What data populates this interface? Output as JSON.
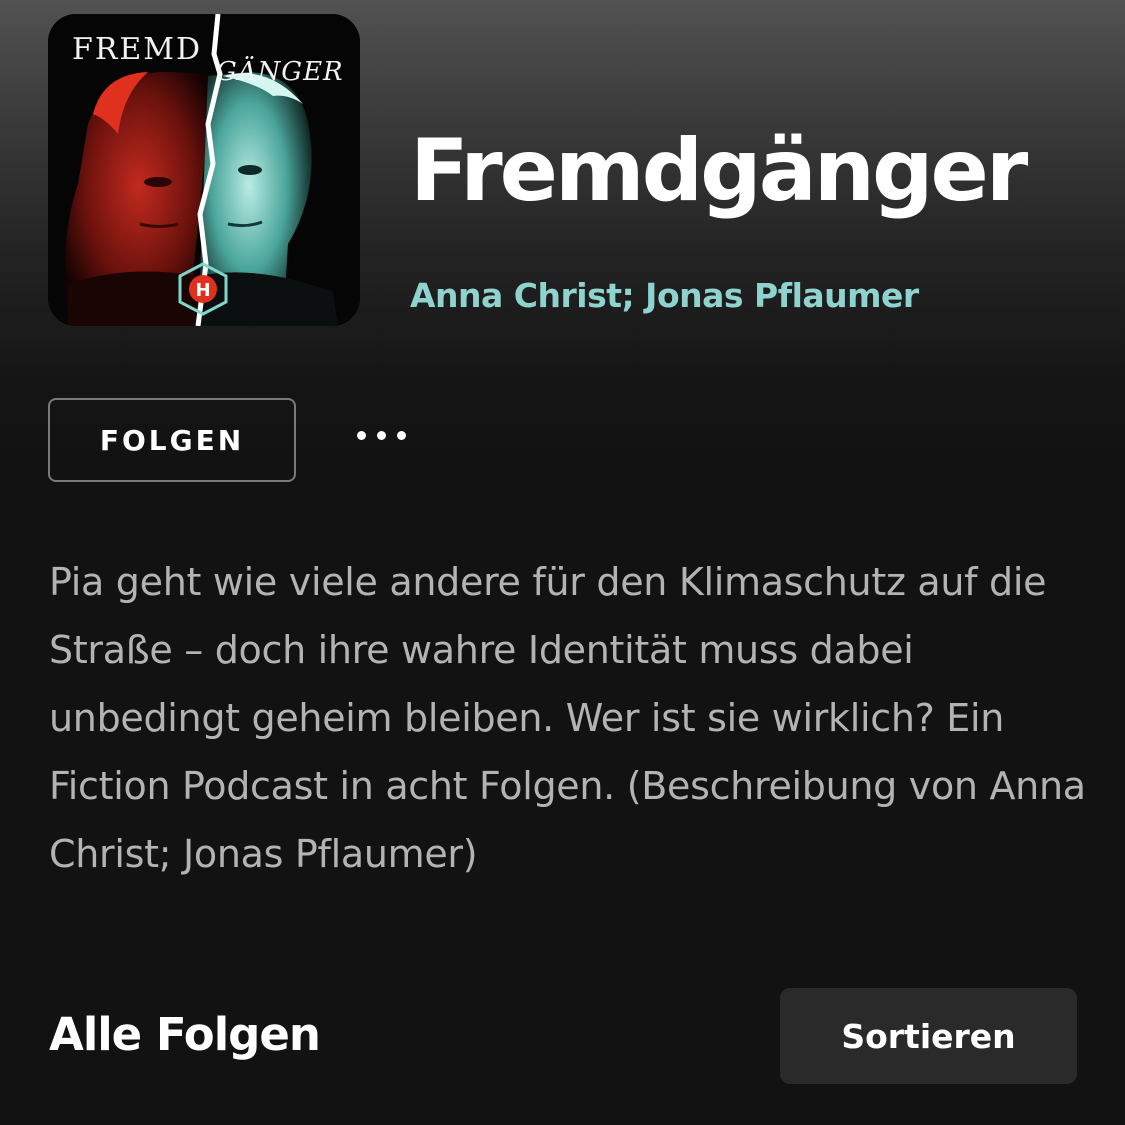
{
  "podcast": {
    "cover": {
      "title_left": "FREMD",
      "title_right": "GÄNGER",
      "logo_letter": "H"
    },
    "title": "Fremdgänger",
    "authors": "Anna Christ; Jonas Pflaumer"
  },
  "actions": {
    "follow_label": "FOLGEN",
    "more_icon": "more-horizontal-icon"
  },
  "description": "Pia geht wie viele andere für den Klimaschutz auf die Straße – doch ihre wahre Identität muss dabei unbedingt geheim bleiben. Wer ist sie wirklich? Ein Fiction Podcast in acht Folgen. (Beschreibung von Anna Christ; Jonas Pflaumer)",
  "episodes": {
    "section_title": "Alle Folgen",
    "sort_label": "Sortieren"
  },
  "colors": {
    "background": "#121212",
    "author_accent": "#8fd3cf",
    "sort_button_bg": "#2a2a2a"
  }
}
